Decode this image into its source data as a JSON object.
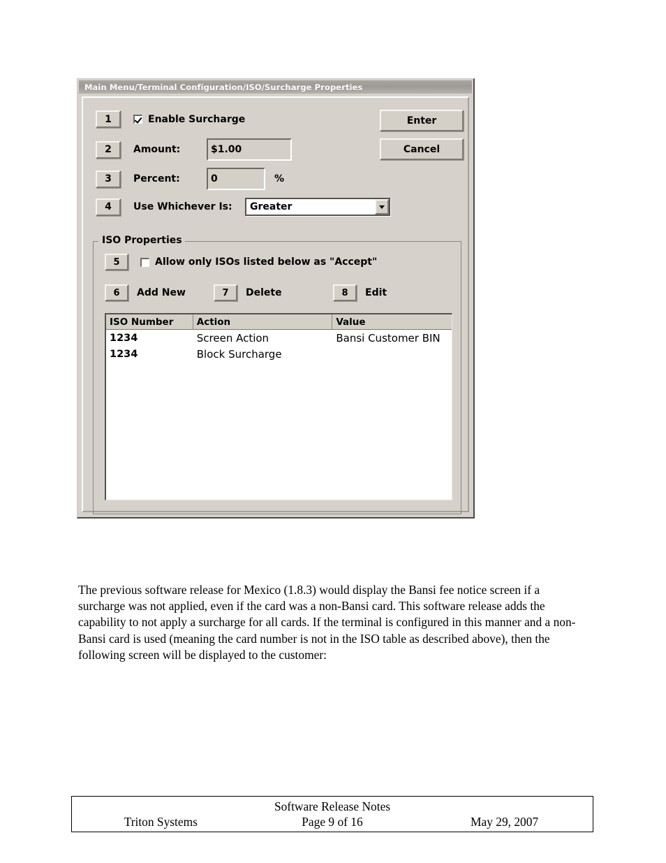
{
  "dialog": {
    "title": "Main Menu/Terminal Configuration/ISO/Surcharge Properties",
    "rows": [
      {
        "key": "1",
        "label": "Enable Surcharge",
        "checkbox": true,
        "checked": true
      },
      {
        "key": "2",
        "label": "Amount:",
        "value": "$1.00"
      },
      {
        "key": "3",
        "label": "Percent:",
        "value": "0",
        "suffix": "%"
      },
      {
        "key": "4",
        "label": "Use Whichever Is:",
        "value": "Greater"
      }
    ],
    "buttons": {
      "enter": "Enter",
      "cancel": "Cancel"
    },
    "combo_options": [
      "Greater"
    ],
    "iso_group": {
      "title": "ISO Properties",
      "allow_only_key": "5",
      "allow_only_label": "Allow only ISOs listed below as \"Accept\"",
      "allow_only_checked": false,
      "actions": [
        {
          "key": "6",
          "label": "Add New"
        },
        {
          "key": "7",
          "label": "Delete"
        },
        {
          "key": "8",
          "label": "Edit"
        }
      ],
      "table": {
        "columns": [
          "ISO Number",
          "Action",
          "Value"
        ],
        "rows": [
          {
            "iso_number": "1234",
            "action": "Screen Action",
            "value": "Bansi Customer BIN"
          },
          {
            "iso_number": "1234",
            "action": "Block Surcharge",
            "value": ""
          }
        ]
      }
    },
    "colors": {
      "titlebar": "#9d9994",
      "face": "#d4d0c8",
      "dialog_bg": "#d6d2cb",
      "shadow": "#7d7a74",
      "highlight": "#ffffff"
    }
  },
  "document": {
    "paragraph": "The previous software release for Mexico (1.8.3) would display the Bansi fee notice screen if a surcharge was not applied, even if the card was a non-Bansi card.  This software release adds the capability to not apply a surcharge for all cards.  If the terminal is configured in this manner and a non-Bansi card is used (meaning the card number is not in the ISO table as described above), then the following screen will be displayed to the customer:",
    "footer": {
      "title": "Software Release Notes",
      "company": "Triton Systems",
      "page": "Page 9 of 16",
      "date": "May 29, 2007"
    }
  }
}
